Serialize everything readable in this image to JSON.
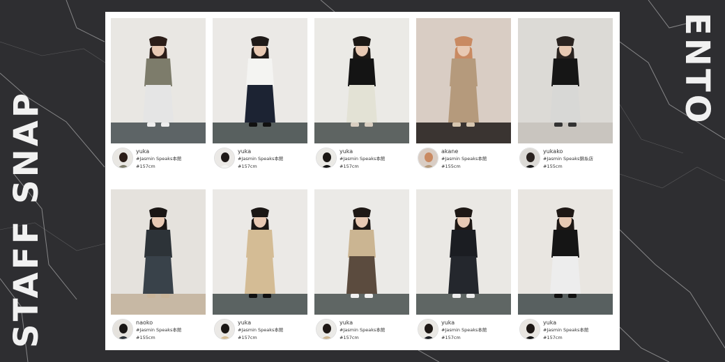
{
  "banner": {
    "left_title": "STAFF SNAP",
    "right_title": "ENTO"
  },
  "colors": {
    "background": "#2e2e31",
    "panel": "#ffffff",
    "title_text": "#f1f1f1"
  },
  "snaps": [
    {
      "name": "yuka",
      "shop": "#Jasmin Speaks本館",
      "height": "#157cm",
      "wall": "#e9e7e3",
      "floor": "#5d6466",
      "hair": "#2b1d18",
      "top": "#7d7c6b",
      "bottom": "#e5e5e5",
      "shoes": "#eeeeee"
    },
    {
      "name": "yuka",
      "shop": "#Jasmin Speaks本館",
      "height": "#157cm",
      "wall": "#ebe9e6",
      "floor": "#58605f",
      "hair": "#1f1a18",
      "top": "#f4f4f2",
      "bottom": "#1c2333",
      "shoes": "#111111"
    },
    {
      "name": "yuka",
      "shop": "#Jasmin Speaks本館",
      "height": "#157cm",
      "wall": "#ebeae6",
      "floor": "#5e6462",
      "hair": "#1c1815",
      "top": "#141414",
      "bottom": "#e3e2d5",
      "shoes": "#d9cfc1"
    },
    {
      "name": "akane",
      "shop": "#Jasmin Speaks本館",
      "height": "#155cm",
      "wall": "#d9cdc4",
      "floor": "#3a3431",
      "hair": "#c98a62",
      "top": "#b59a7c",
      "bottom": "#b59a7c",
      "shoes": "#d8c7b0"
    },
    {
      "name": "yukako",
      "shop": "#Jasmin Speaks錦糸店",
      "height": "#155cm",
      "wall": "#dcdad6",
      "floor": "#c9c5bf",
      "hair": "#2a2320",
      "top": "#161616",
      "bottom": "#d8d8d6",
      "shoes": "#333333"
    },
    {
      "name": "naoko",
      "shop": "#Jasmin Speaks本館",
      "height": "#155cm",
      "wall": "#e5e2dd",
      "floor": "#c7b8a4",
      "hair": "#1a1614",
      "top": "#2d3338",
      "bottom": "#39424a",
      "shoes": "#c9b59a"
    },
    {
      "name": "yuka",
      "shop": "#Jasmin Speaks本館",
      "height": "#157cm",
      "wall": "#ebe9e6",
      "floor": "#5b6362",
      "hair": "#1b1715",
      "top": "#d4bc95",
      "bottom": "#d4bc95",
      "shoes": "#111111"
    },
    {
      "name": "yuka",
      "shop": "#Jasmin Speaks本館",
      "height": "#157cm",
      "wall": "#ebeae7",
      "floor": "#5f6664",
      "hair": "#1e1815",
      "top": "#cbb592",
      "bottom": "#5b4b3e",
      "shoes": "#f1f1f1"
    },
    {
      "name": "yuka",
      "shop": "#Jasmin Speaks本館",
      "height": "#157cm",
      "wall": "#eae8e4",
      "floor": "#5f6664",
      "hair": "#1e1815",
      "top": "#1b1d22",
      "bottom": "#24272d",
      "shoes": "#ececec"
    },
    {
      "name": "yuka",
      "shop": "#Jasmin Speaks本館",
      "height": "#157cm",
      "wall": "#e9e6e1",
      "floor": "#586060",
      "hair": "#1e1815",
      "top": "#151515",
      "bottom": "#ededed",
      "shoes": "#111111"
    }
  ]
}
